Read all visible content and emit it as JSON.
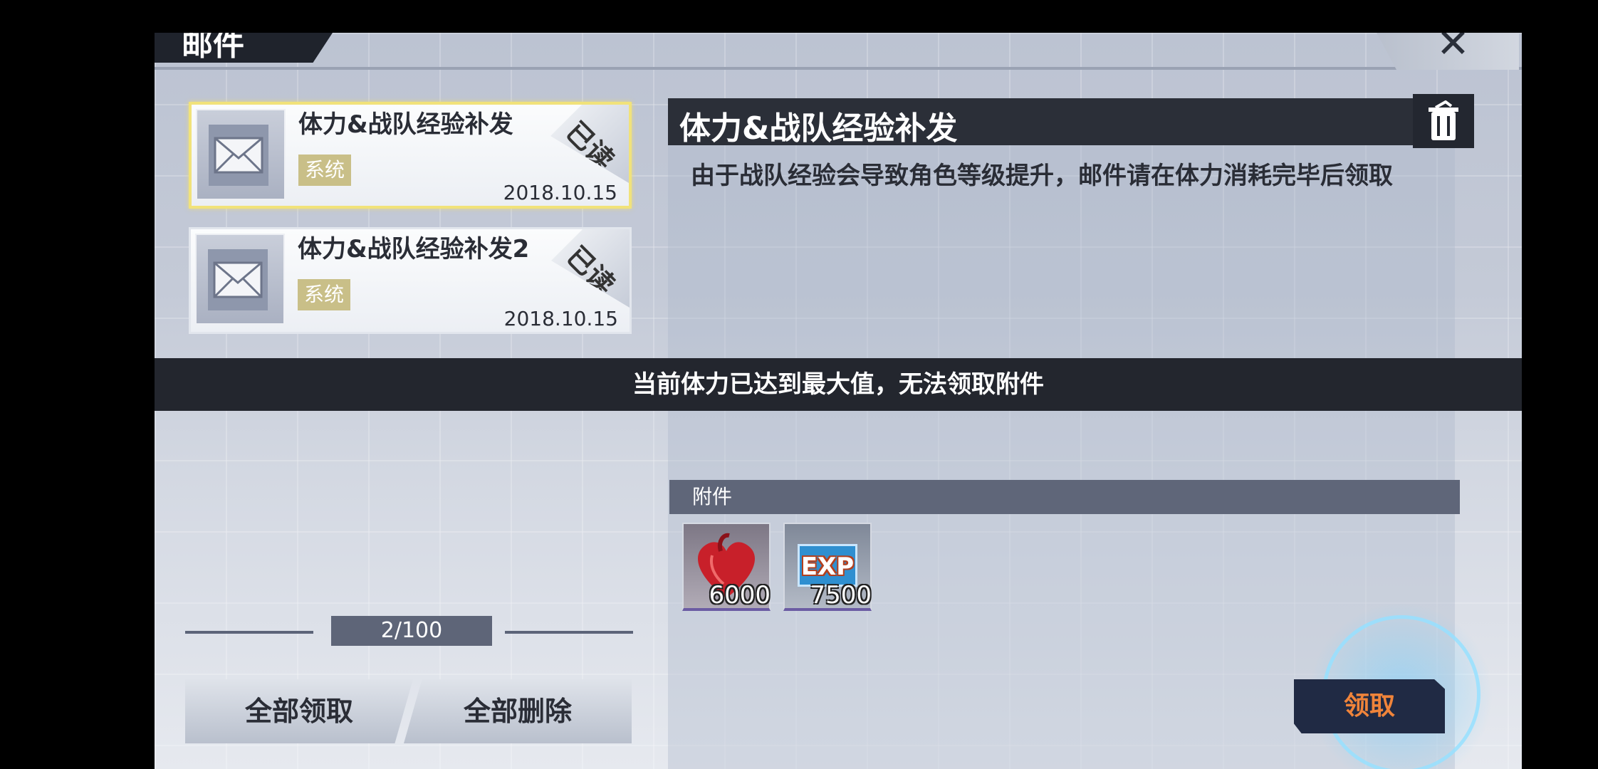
{
  "header": {
    "title": "邮件",
    "close_label": "✕"
  },
  "mails": [
    {
      "title": "体力&战队经验补发",
      "tag": "系统",
      "date": "2018.10.15",
      "status": "已读",
      "selected": true
    },
    {
      "title": "体力&战队经验补发2",
      "tag": "系统",
      "date": "2018.10.15",
      "status": "已读",
      "selected": false
    }
  ],
  "detail": {
    "title": "体力&战队经验补发",
    "body": "由于战队经验会导致角色等级提升，邮件请在体力消耗完毕后领取"
  },
  "toast": "当前体力已达到最大值，无法领取附件",
  "attachments": {
    "header": "附件",
    "items": [
      {
        "icon": "heart-icon",
        "count": "6000"
      },
      {
        "icon": "exp-icon",
        "label": "EXP",
        "count": "7500"
      }
    ]
  },
  "pager": "2/100",
  "buttons": {
    "claim_all": "全部领取",
    "delete_all": "全部删除",
    "claim": "领取"
  },
  "colors": {
    "accent": "#f0843a",
    "selected_border": "#f1e27a",
    "tag_bg": "#c9bf88"
  }
}
